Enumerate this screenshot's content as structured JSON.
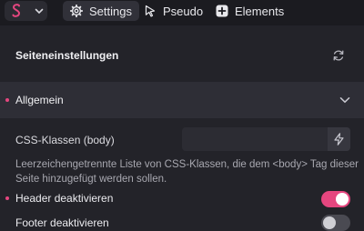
{
  "toolbar": {
    "logo_icon": "bricks-logo-icon",
    "tabs": [
      {
        "label": "Settings",
        "icon": "gear-icon",
        "active": true
      },
      {
        "label": "Pseudo",
        "icon": "cursor-icon",
        "active": false
      },
      {
        "label": "Elements",
        "icon": "plus-square-icon",
        "active": false
      }
    ]
  },
  "panel": {
    "title": "Seiteneinstellungen",
    "refresh_icon": "refresh-icon",
    "accordion": {
      "title": "Allgemein",
      "expanded": true
    },
    "css_classes": {
      "label": "CSS-Klassen (body)",
      "value": "",
      "help": "Leerzeichengetrennte Liste von CSS-Klassen, die dem <body> Tag dieser Seite hinzugefügt werden sollen."
    },
    "header_toggle": {
      "label": "Header deaktivieren",
      "on": true
    },
    "footer_toggle": {
      "label": "Footer deaktivieren",
      "on": false
    }
  },
  "colors": {
    "accent": "#e5467f",
    "background": "#232329",
    "header": "#1b1b20"
  }
}
